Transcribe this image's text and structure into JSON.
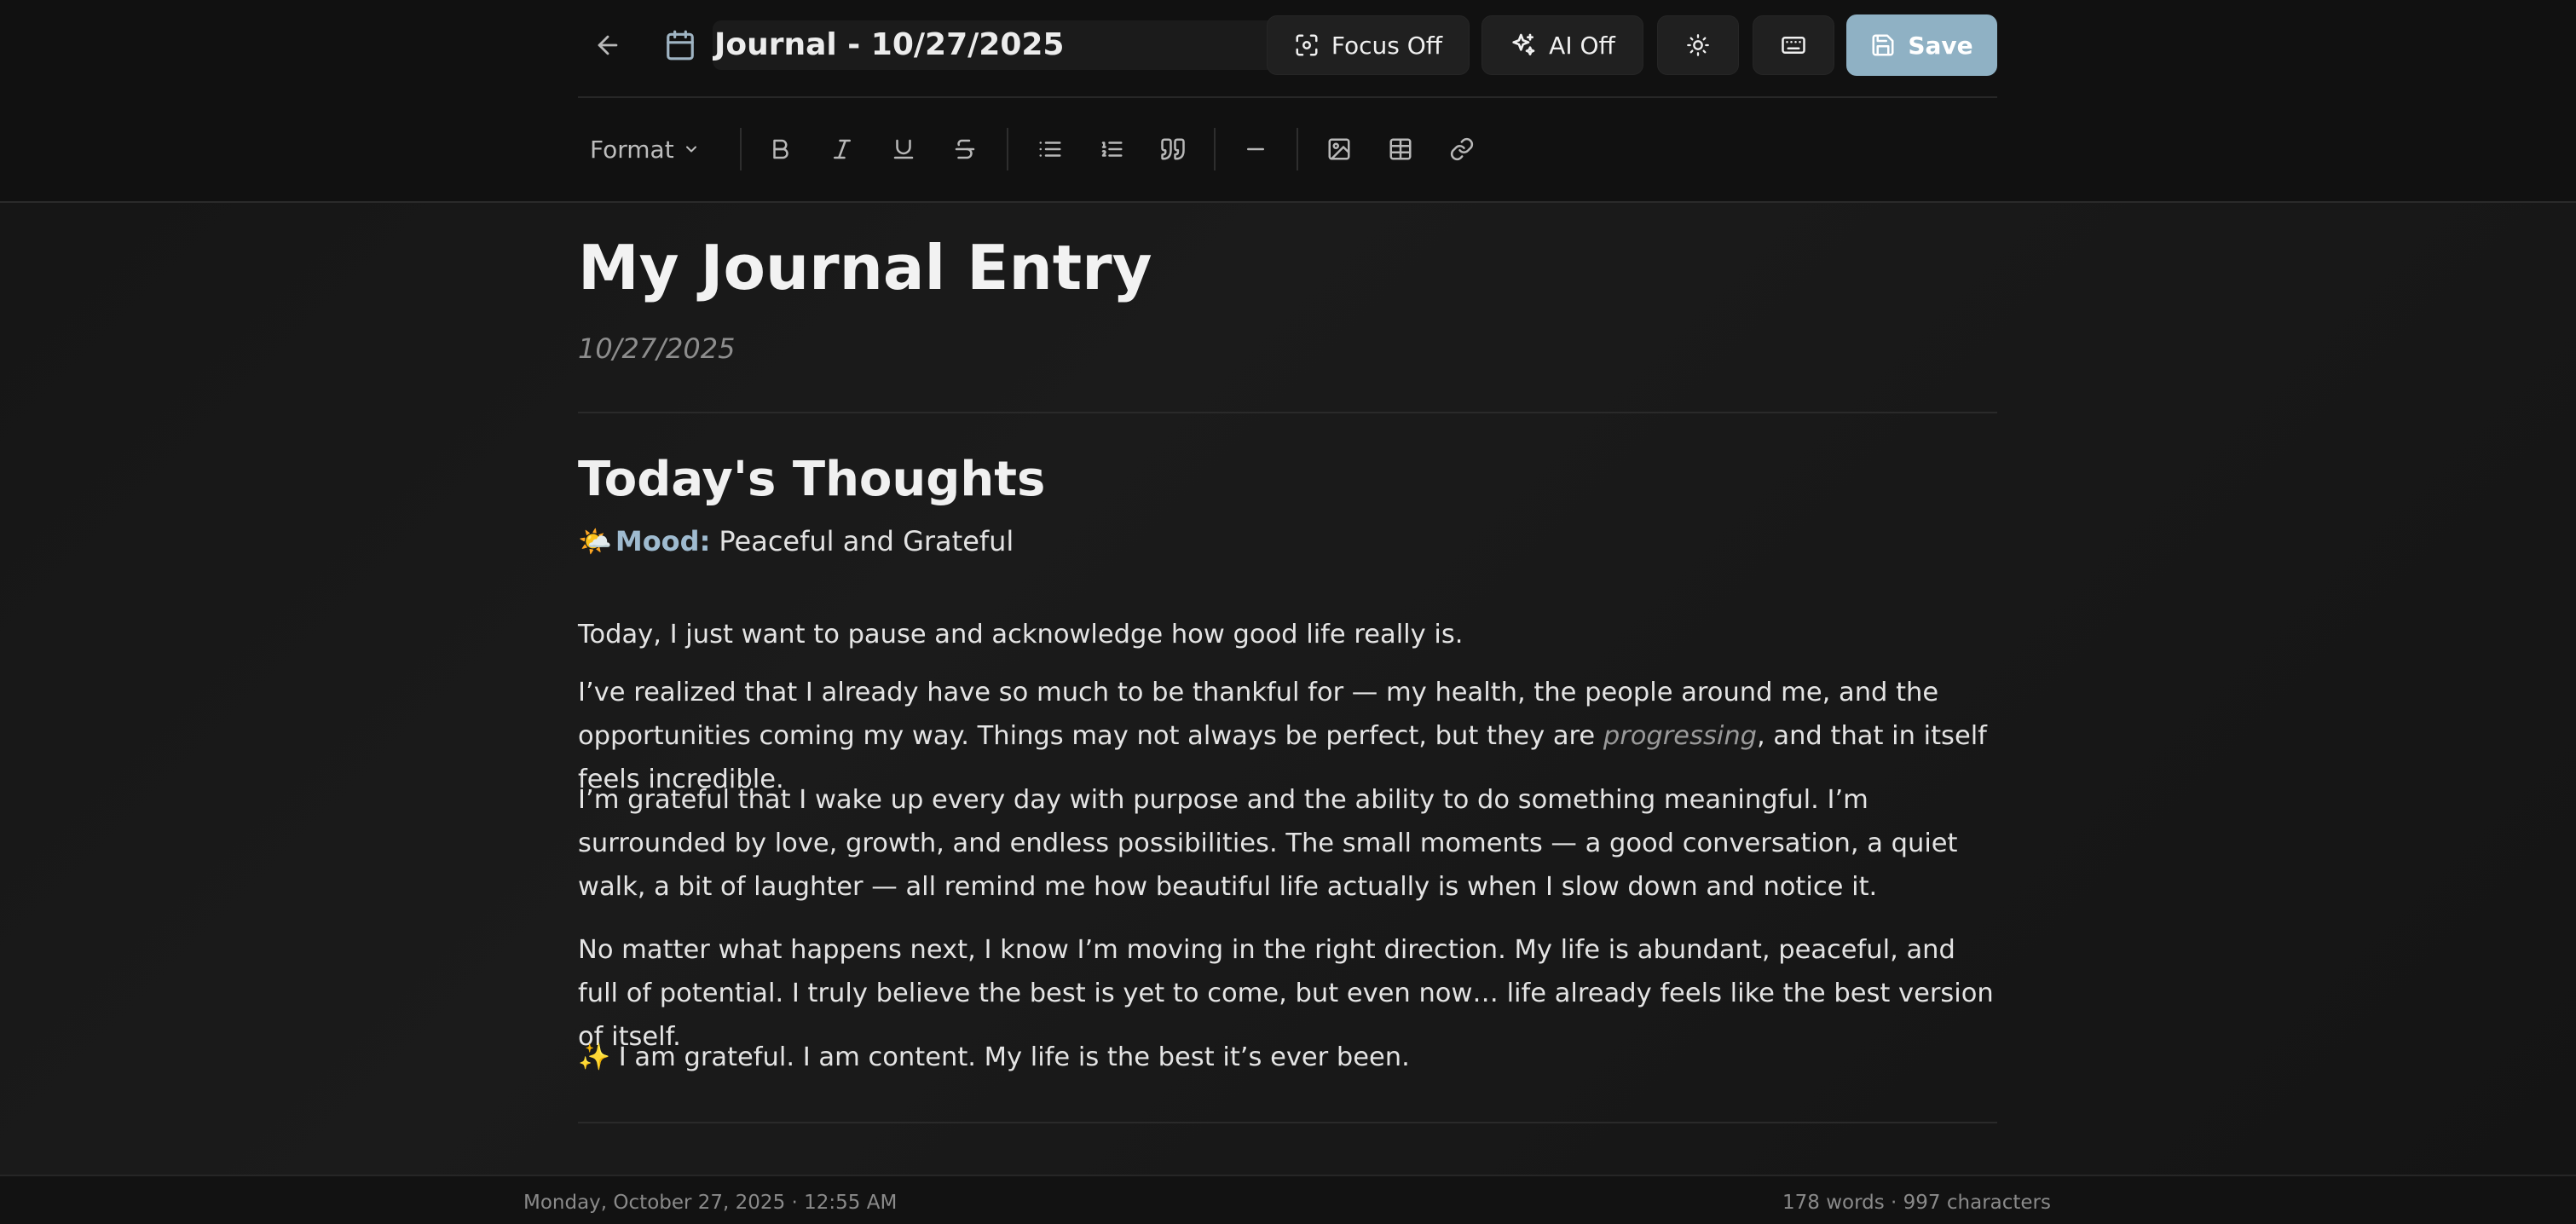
{
  "header": {
    "back_icon": "arrow-left-icon",
    "calendar_icon": "calendar-icon",
    "title": "Journal - 10/27/2025",
    "focus_label": "Focus Off",
    "ai_label": "AI Off",
    "theme_icon": "sun-icon",
    "keyboard_icon": "keyboard-icon",
    "save_label": "Save",
    "save_color": "#8fb1c4"
  },
  "toolbar": {
    "format_label": "Format",
    "buttons": [
      "bold-icon",
      "italic-icon",
      "underline-icon",
      "strikethrough-icon",
      "bullet-list-icon",
      "numbered-list-icon",
      "quote-icon",
      "horizontal-rule-icon",
      "image-icon",
      "table-icon",
      "link-icon"
    ]
  },
  "document": {
    "title": "My Journal Entry",
    "date": "10/27/2025",
    "heading": "Today's Thoughts",
    "mood_emoji": "🌤️",
    "mood_label": "Mood:",
    "mood_value": "Peaceful and Grateful",
    "p1": "Today, I just want to pause and acknowledge how good life really is.",
    "p2_before": "I’ve realized that I already have so much to be thankful for — my health, the people around me, and the opportunities coming my way. Things may not always be perfect, but they are ",
    "p2_em": "progressing",
    "p2_after": ", and that in itself feels incredible.",
    "p3": "I’m grateful that I wake up every day with purpose and the ability to do something meaningful. I’m surrounded by love, growth, and endless possibilities. The small moments — a good conversation, a quiet walk, a bit of laughter — all remind me how beautiful life actually is when I slow down and notice it.",
    "p4": "No matter what happens next, I know I’m moving in the right direction. My life is abundant, peaceful, and full of potential. I truly believe the best is yet to come, but even now… life already feels like the best version of itself.",
    "p5_emoji": "✨",
    "p5": "I am grateful. I am content. My life is the best it’s ever been."
  },
  "footer": {
    "timestamp": "Monday, October 27, 2025 · 12:55 AM",
    "counts": "178 words · 997 characters"
  },
  "colors": {
    "background": "#141414",
    "accent": "#9fbbd0"
  }
}
